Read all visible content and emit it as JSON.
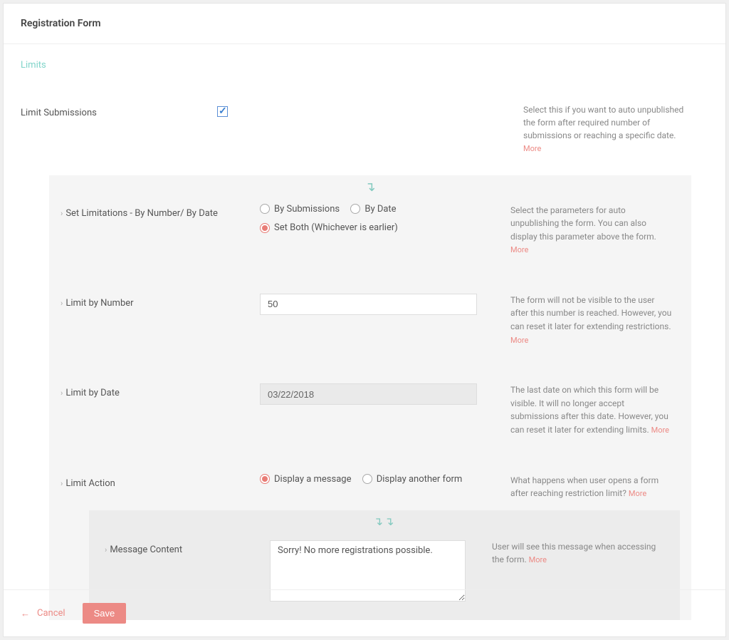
{
  "header": {
    "title": "Registration Form"
  },
  "tabs": {
    "limits": "Limits"
  },
  "limitSubmissions": {
    "label": "Limit Submissions",
    "checked": true,
    "help": "Select this if you want to auto unpublished the form after required number of submissions or reaching a specific date.",
    "more": "More"
  },
  "setLimitations": {
    "label": "Set Limitations - By Number/ By Date",
    "options": {
      "bySubmissions": "By Submissions",
      "byDate": "By Date",
      "setBoth": "Set Both (Whichever is earlier)"
    },
    "selected": "setBoth",
    "help": "Select the parameters for auto unpublishing the form. You can also display this parameter above the form.",
    "more": "More"
  },
  "limitByNumber": {
    "label": "Limit by Number",
    "value": "50",
    "help": "The form will not be visible to the user after this number is reached. However, you can reset it later for extending restrictions.",
    "more": "More"
  },
  "limitByDate": {
    "label": "Limit by Date",
    "value": "03/22/2018",
    "help": "The last date on which this form will be visible. It will no longer accept submissions after this date. However, you can reset it later for extending limits.",
    "more": "More"
  },
  "limitAction": {
    "label": "Limit Action",
    "options": {
      "displayMessage": "Display a message",
      "displayForm": "Display another form"
    },
    "selected": "displayMessage",
    "help": "What happens when user opens a form after reaching restriction limit?",
    "more": "More"
  },
  "messageContent": {
    "label": "Message Content",
    "value": "Sorry! No more registrations possible.",
    "help": "User will see this message when accessing the form.",
    "more": "More"
  },
  "footer": {
    "cancel": "Cancel",
    "save": "Save"
  }
}
